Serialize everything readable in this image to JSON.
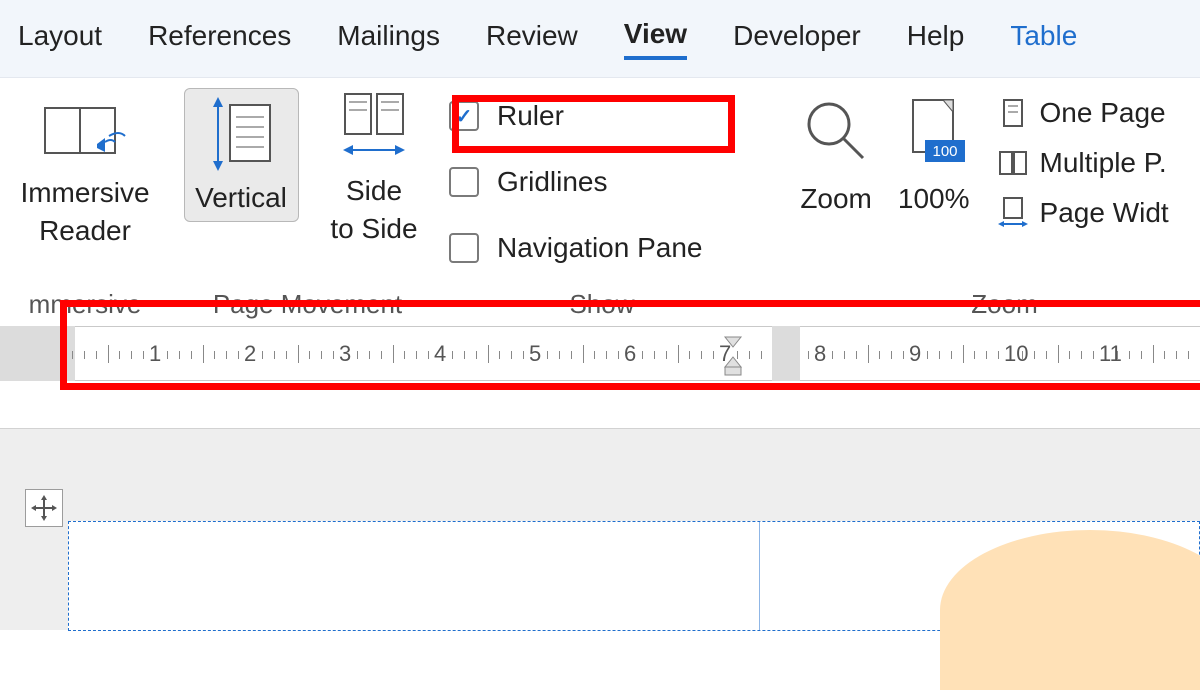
{
  "tabs": {
    "layout": "Layout",
    "references": "References",
    "mailings": "Mailings",
    "review": "Review",
    "view": "View",
    "developer": "Developer",
    "help": "Help",
    "table": "Table"
  },
  "ribbon": {
    "immersive": {
      "label": "Immersive Reader",
      "group": "mmersive"
    },
    "pagemove": {
      "vertical": "Vertical",
      "sidetoside": "Side to Side",
      "group": "Page Movement"
    },
    "show": {
      "ruler": "Ruler",
      "gridlines": "Gridlines",
      "navpane": "Navigation Pane",
      "group": "Show"
    },
    "zoom": {
      "zoom": "Zoom",
      "hundred": "100%",
      "onepage": "One Page",
      "multiple": "Multiple P.",
      "pagewidth": "Page Widt",
      "group": "Zoom",
      "badge": "100"
    }
  },
  "ruler": {
    "numbers": [
      "1",
      "2",
      "3",
      "4",
      "5",
      "6",
      "7",
      "8",
      "9",
      "10",
      "11"
    ]
  }
}
